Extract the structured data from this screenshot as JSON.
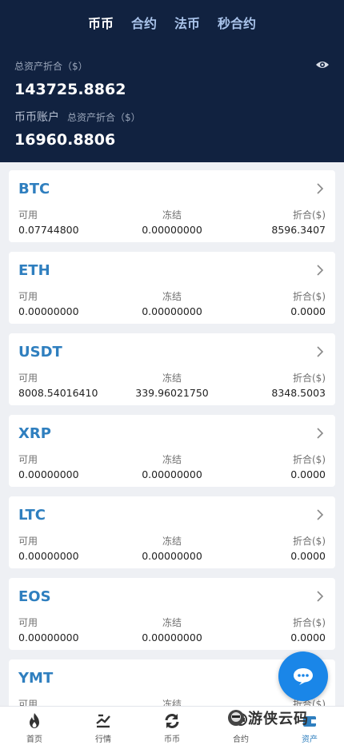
{
  "tabs": [
    {
      "label": "币币",
      "active": true
    },
    {
      "label": "合约",
      "active": false
    },
    {
      "label": "法币",
      "active": false
    },
    {
      "label": "秒合约",
      "active": false
    }
  ],
  "summary": {
    "total_label": "总资产折合（$）",
    "total_value": "143725.8862",
    "account_name": "币币账户",
    "account_sub_label": "总资产折合（$）",
    "account_value": "16960.8806"
  },
  "columns": {
    "available": "可用",
    "frozen": "冻结",
    "converted": "折合($)"
  },
  "assets": [
    {
      "coin": "BTC",
      "available": "0.07744800",
      "frozen": "0.00000000",
      "converted": "8596.3407"
    },
    {
      "coin": "ETH",
      "available": "0.00000000",
      "frozen": "0.00000000",
      "converted": "0.0000"
    },
    {
      "coin": "USDT",
      "available": "8008.54016410",
      "frozen": "339.96021750",
      "converted": "8348.5003"
    },
    {
      "coin": "XRP",
      "available": "0.00000000",
      "frozen": "0.00000000",
      "converted": "0.0000"
    },
    {
      "coin": "LTC",
      "available": "0.00000000",
      "frozen": "0.00000000",
      "converted": "0.0000"
    },
    {
      "coin": "EOS",
      "available": "0.00000000",
      "frozen": "0.00000000",
      "converted": "0.0000"
    },
    {
      "coin": "YMT",
      "available": "",
      "frozen": "",
      "converted": ""
    }
  ],
  "tabbar": [
    {
      "label": "首页",
      "icon": "fire-icon",
      "active": false
    },
    {
      "label": "行情",
      "icon": "chart-icon",
      "active": false
    },
    {
      "label": "币币",
      "icon": "exchange-icon",
      "active": false
    },
    {
      "label": "合约",
      "icon": "contract-icon",
      "active": false
    },
    {
      "label": "资产",
      "icon": "wallet-icon",
      "active": true
    }
  ],
  "watermark": {
    "text": "游侠云码"
  },
  "colors": {
    "header_bg": "#112240",
    "accent": "#2f7fbf",
    "fab": "#1a86e8"
  }
}
